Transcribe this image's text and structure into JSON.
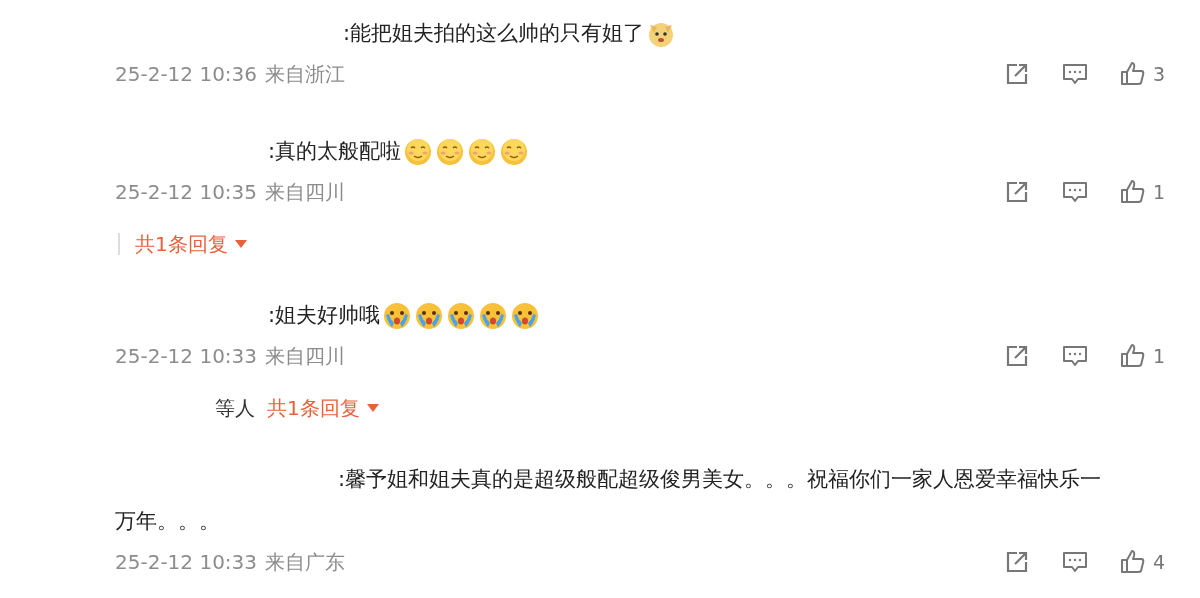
{
  "comments": [
    {
      "text": ":能把姐夫拍的这么帅的只有姐了",
      "emojis": [
        {
          "kind": "doge"
        }
      ],
      "time": "25-2-12 10:36",
      "location": "来自浙江",
      "likes": "3"
    },
    {
      "text": ":真的太般配啦",
      "emojis": [
        {
          "kind": "smile"
        },
        {
          "kind": "smile"
        },
        {
          "kind": "smile"
        },
        {
          "kind": "smile"
        }
      ],
      "time": "25-2-12 10:35",
      "location": "来自四川",
      "likes": "1",
      "replies": {
        "divider": true,
        "label": "共1条回复"
      }
    },
    {
      "text": ":姐夫好帅哦",
      "emojis": [
        {
          "kind": "cry"
        },
        {
          "kind": "cry"
        },
        {
          "kind": "cry"
        },
        {
          "kind": "cry"
        },
        {
          "kind": "cry"
        }
      ],
      "time": "25-2-12 10:33",
      "location": "来自四川",
      "likes": "1",
      "replies": {
        "divider": false,
        "prefix": "等人",
        "label": "共1条回复"
      }
    },
    {
      "text": ":馨予姐和姐夫真的是超级般配超级俊男美女。。。祝福你们一家人恩爱幸福快乐一万年。。。",
      "time": "25-2-12 10:33",
      "location": "来自广东",
      "likes": "4"
    }
  ]
}
